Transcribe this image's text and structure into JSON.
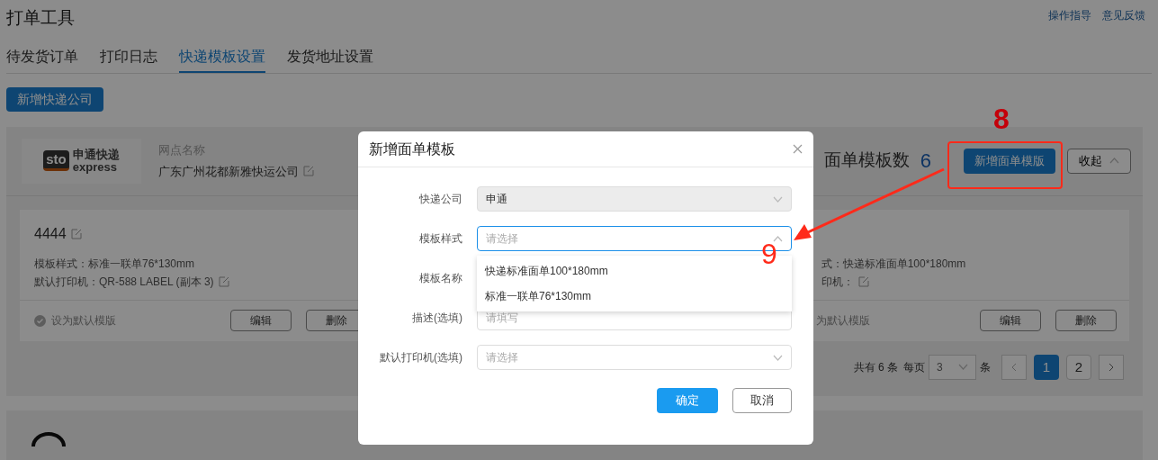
{
  "header": {
    "title": "打单工具",
    "links": [
      "操作指导",
      "意见反馈"
    ]
  },
  "tabs": [
    {
      "label": "待发货订单",
      "selected": false
    },
    {
      "label": "打印日志",
      "selected": false
    },
    {
      "label": "快递模板设置",
      "selected": true
    },
    {
      "label": "发货地址设置",
      "selected": false
    }
  ],
  "add_company_button": "新增快递公司",
  "company_card": {
    "logo": {
      "mark": "sto",
      "name": "申通快递",
      "sub": "express"
    },
    "branch_label": "网点名称",
    "branch_name": "广东广州花都新雅快运公司",
    "template_count_label": "面单模板数",
    "template_count": "6",
    "add_template_button": "新增面单模版",
    "collapse_button": "收起"
  },
  "templates": [
    {
      "title": "4444",
      "style": "模板样式：标准一联单76*130mm",
      "printer": "默认打印机：QR-588 LABEL (副本 3)",
      "default_label": "设为默认模版",
      "buttons": [
        "编辑",
        "删除"
      ]
    },
    {
      "style": "式：快递标准面单100*180mm",
      "printer": "印机：",
      "default_label": "为默认模版",
      "buttons": [
        "编辑",
        "删除"
      ]
    }
  ],
  "pagination": {
    "total": "共有 6 条",
    "per_page_label": "每页",
    "per_page": "3",
    "unit": "条",
    "pages": [
      {
        "label": "1",
        "selected": true
      },
      {
        "label": "2",
        "selected": false
      }
    ]
  },
  "modal": {
    "title": "新增面单模板",
    "fields": [
      {
        "label": "快递公司",
        "kind": "select",
        "value": "申通",
        "disabled": true,
        "expanded": false
      },
      {
        "label": "模板样式",
        "kind": "select",
        "placeholder": "请选择",
        "disabled": false,
        "expanded": true
      },
      {
        "label": "模板名称",
        "kind": "input"
      },
      {
        "label": "描述(选填)",
        "kind": "input",
        "placeholder": "请填写"
      },
      {
        "label": "默认打印机(选填)",
        "kind": "select",
        "placeholder": "请选择",
        "disabled": false,
        "expanded": false
      }
    ],
    "dropdown_options": [
      "快递标准面单100*180mm",
      "标准一联单76*130mm"
    ],
    "confirm_button": "确定",
    "cancel_button": "取消"
  },
  "annotations": [
    {
      "text": "8"
    },
    {
      "text": "9"
    }
  ]
}
